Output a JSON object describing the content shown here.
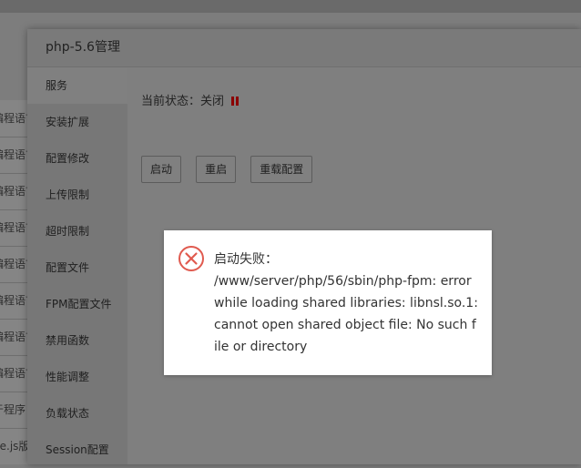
{
  "window": {
    "title": "php-5.6管理"
  },
  "background_list": {
    "rows": [
      "编程语言",
      "编程语言",
      "编程语言",
      "编程语言",
      "编程语言",
      "编程语言",
      "编程语言",
      "编程语言",
      "于程序",
      "de.js版"
    ]
  },
  "sidebar": {
    "items": [
      {
        "label": "服务",
        "active": true
      },
      {
        "label": "安装扩展"
      },
      {
        "label": "配置修改"
      },
      {
        "label": "上传限制"
      },
      {
        "label": "超时限制"
      },
      {
        "label": "配置文件"
      },
      {
        "label": "FPM配置文件"
      },
      {
        "label": "禁用函数"
      },
      {
        "label": "性能调整"
      },
      {
        "label": "负载状态"
      },
      {
        "label": "Session配置"
      }
    ]
  },
  "service": {
    "status_label": "当前状态：关闭",
    "status_color": "#8b0000",
    "buttons": {
      "start": "启动",
      "restart": "重启",
      "reload": "重载配置"
    }
  },
  "error_toast": {
    "icon": "error-circle-icon",
    "icon_color": "#e05a4f",
    "title": "启动失败：",
    "message": "/www/server/php/56/sbin/php-fpm: error while loading shared libraries: libnsl.so.1: cannot open shared object file: No such file or directory"
  }
}
